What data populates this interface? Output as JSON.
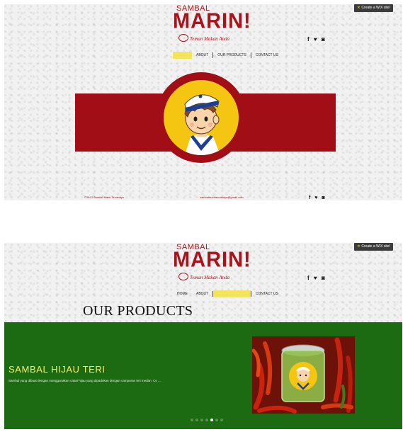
{
  "brand": {
    "small": "SAMBAL",
    "large": "MARIN!",
    "tagline": "Teman Makan Anda",
    "color": "#a8141b"
  },
  "wix_badge": "Create a WIX site!",
  "social_icons": [
    "f",
    "♥",
    "◙"
  ],
  "nav": {
    "items": [
      "HOME",
      "ABOUT",
      "OUR PRODUCTS",
      "CONTACT US"
    ],
    "active_color": "#f3e45a"
  },
  "screen1": {
    "active_nav": "HOME",
    "footer_left": "©2013 Sambal Marin Surabaya",
    "footer_mid": "sambalmarinsurabaya@gmail.com",
    "hero_colors": {
      "bar": "#a10e16",
      "face": "#f4c612"
    }
  },
  "screen2": {
    "active_nav": "OUR PRODUCTS",
    "title": "OUR PRODUCTS",
    "product": {
      "name": "SAMBAL HIJAU TERI",
      "description": "Sambal yang dibuat dengan menggunakan cabai hijau yang dipadukan dengan campuran teri medan. Co ..."
    },
    "slider": {
      "color": "#1c6b13",
      "count": 7,
      "active_index": 4
    }
  }
}
